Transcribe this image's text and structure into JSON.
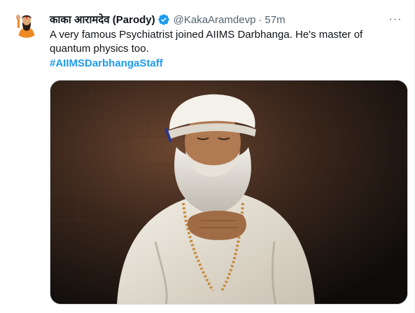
{
  "tweet": {
    "display_name": "काका आरामदेव (Parody)",
    "handle": "@KakaAramdevp",
    "separator": "·",
    "time": "57m",
    "more_label": "···",
    "text": "A very famous Psychiatrist joined AIIMS Darbhanga. He's master of quantum physics too.",
    "hashtag": "#AIIMSDarbhangaStaff"
  },
  "icons": {
    "verified": "verified-badge-icon",
    "more": "more-options-icon"
  },
  "colors": {
    "link": "#1d9bf0",
    "secondary_text": "#536471",
    "primary_text": "#0f1419"
  }
}
